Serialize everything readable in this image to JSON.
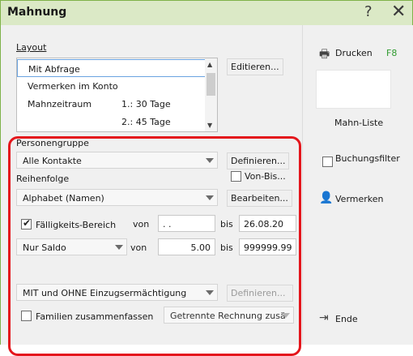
{
  "window": {
    "title": "Mahnung",
    "help_glyph": "?",
    "close_glyph": "✕"
  },
  "layout": {
    "label": "Layout",
    "edit_button": "Editieren...",
    "items": [
      {
        "label": "Mit Abfrage",
        "sub": ""
      },
      {
        "label": "Vermerken im Konto",
        "sub": ""
      },
      {
        "label": "Mahnzeitraum",
        "sub": "1.:  30 Tage"
      },
      {
        "label": "",
        "sub": "2.:  45 Tage"
      }
    ]
  },
  "personengruppe": {
    "label": "Personengruppe",
    "value": "Alle Kontakte",
    "define_button": "Definieren...",
    "von_bis_label": "Von-Bis..."
  },
  "reihenfolge": {
    "label": "Reihenfolge",
    "value": "Alphabet (Namen)",
    "edit_button": "Bearbeiten..."
  },
  "faelligkeit": {
    "label": "Fälligkeits-Bereich",
    "checked": true,
    "von_label": "von",
    "von_value": " .  .",
    "bis_label": "bis",
    "bis_value": "26.08.20"
  },
  "saldo": {
    "value": "Nur Saldo",
    "von_label": "von",
    "von_value": "5.00",
    "bis_label": "bis",
    "bis_value": "999999.99"
  },
  "einzug": {
    "value": "MIT und OHNE Einzugsermächtigung",
    "define_button": "Definieren..."
  },
  "familien": {
    "label": "Familien zusammenfassen",
    "checked": false,
    "rechnung_value": "Getrennte Rechnung zusä"
  },
  "actions": {
    "print_label": "Drucken",
    "print_shortcut": "F8",
    "mahnliste_label": "Mahn-Liste",
    "buchungsfilter_label": "Buchungsfilter",
    "vermerken_label": "Vermerken",
    "ende_label": "Ende"
  },
  "colors": {
    "titlebar": "#dbe9c6",
    "highlight_box": "#e4161c",
    "shortcut": "#2e9a2e",
    "selection_border": "#6aa3e0"
  },
  "icons": {
    "print": "printer-icon",
    "user": "user-note-icon",
    "exit": "exit-icon"
  }
}
